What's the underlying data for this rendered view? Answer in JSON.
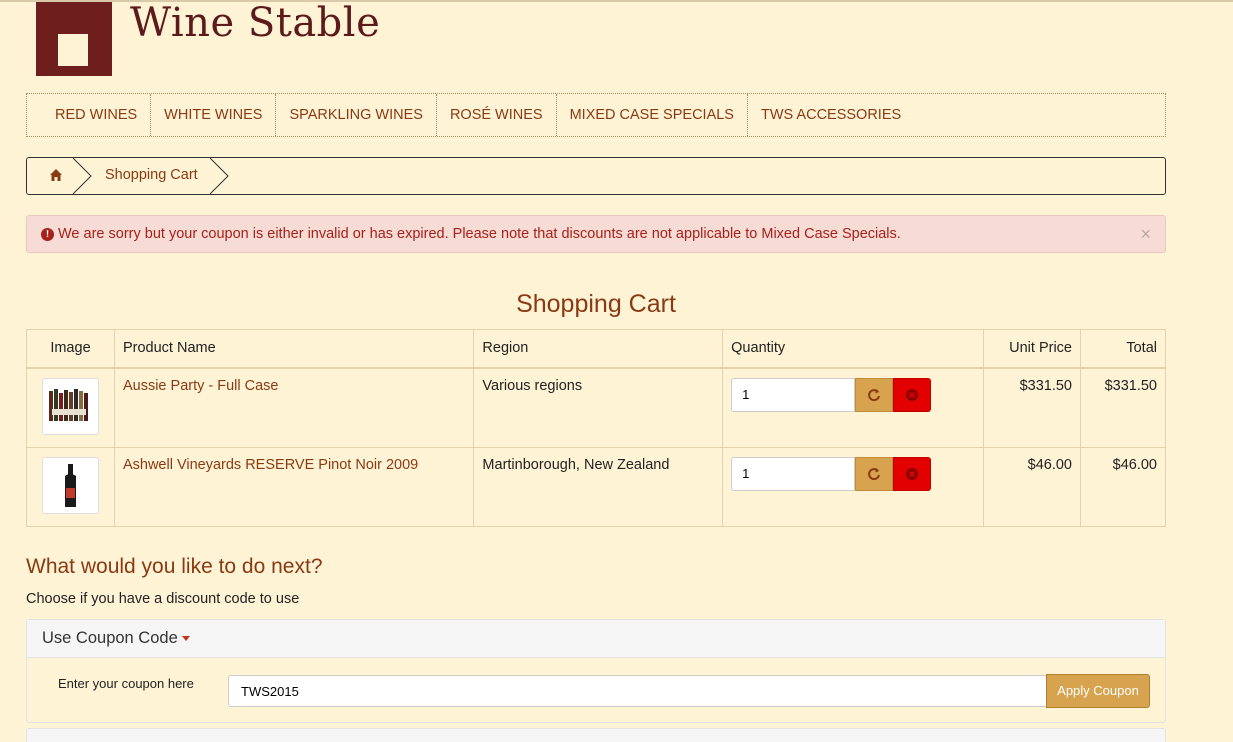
{
  "brand": {
    "name": "Wine Stable",
    "color": "#6e1f1d"
  },
  "nav": {
    "items": [
      "RED WINES",
      "WHITE WINES",
      "SPARKLING WINES",
      "ROSÉ WINES",
      "MIXED CASE SPECIALS",
      "TWS ACCESSORIES"
    ]
  },
  "breadcrumb": {
    "home_icon": "home-icon",
    "current": "Shopping Cart"
  },
  "alert": {
    "icon": "exclamation-circle-icon",
    "message": "We are sorry but your coupon is either invalid or has expired. Please note that discounts are not applicable to Mixed Case Specials.",
    "close": "×"
  },
  "cart": {
    "title": "Shopping Cart",
    "headers": {
      "image": "Image",
      "name": "Product Name",
      "region": "Region",
      "quantity": "Quantity",
      "unit": "Unit Price",
      "total": "Total"
    },
    "rows": [
      {
        "name": "Aussie Party - Full Case",
        "region": "Various regions",
        "qty": "1",
        "unit": "$331.50",
        "total": "$331.50"
      },
      {
        "name": "Ashwell Vineyards RESERVE Pinot Noir 2009",
        "region": "Martinborough, New Zealand",
        "qty": "1",
        "unit": "$46.00",
        "total": "$46.00"
      }
    ]
  },
  "next": {
    "title": "What would you like to do next?",
    "subtitle": "Choose if you have a discount code to use"
  },
  "coupon": {
    "heading": "Use Coupon Code",
    "label": "Enter your coupon here",
    "value": "TWS2015",
    "button": "Apply Coupon"
  },
  "colors": {
    "accent": "#8a3a12",
    "gold": "#d8a34e",
    "danger": "#e20000",
    "background": "#fff3d6"
  }
}
